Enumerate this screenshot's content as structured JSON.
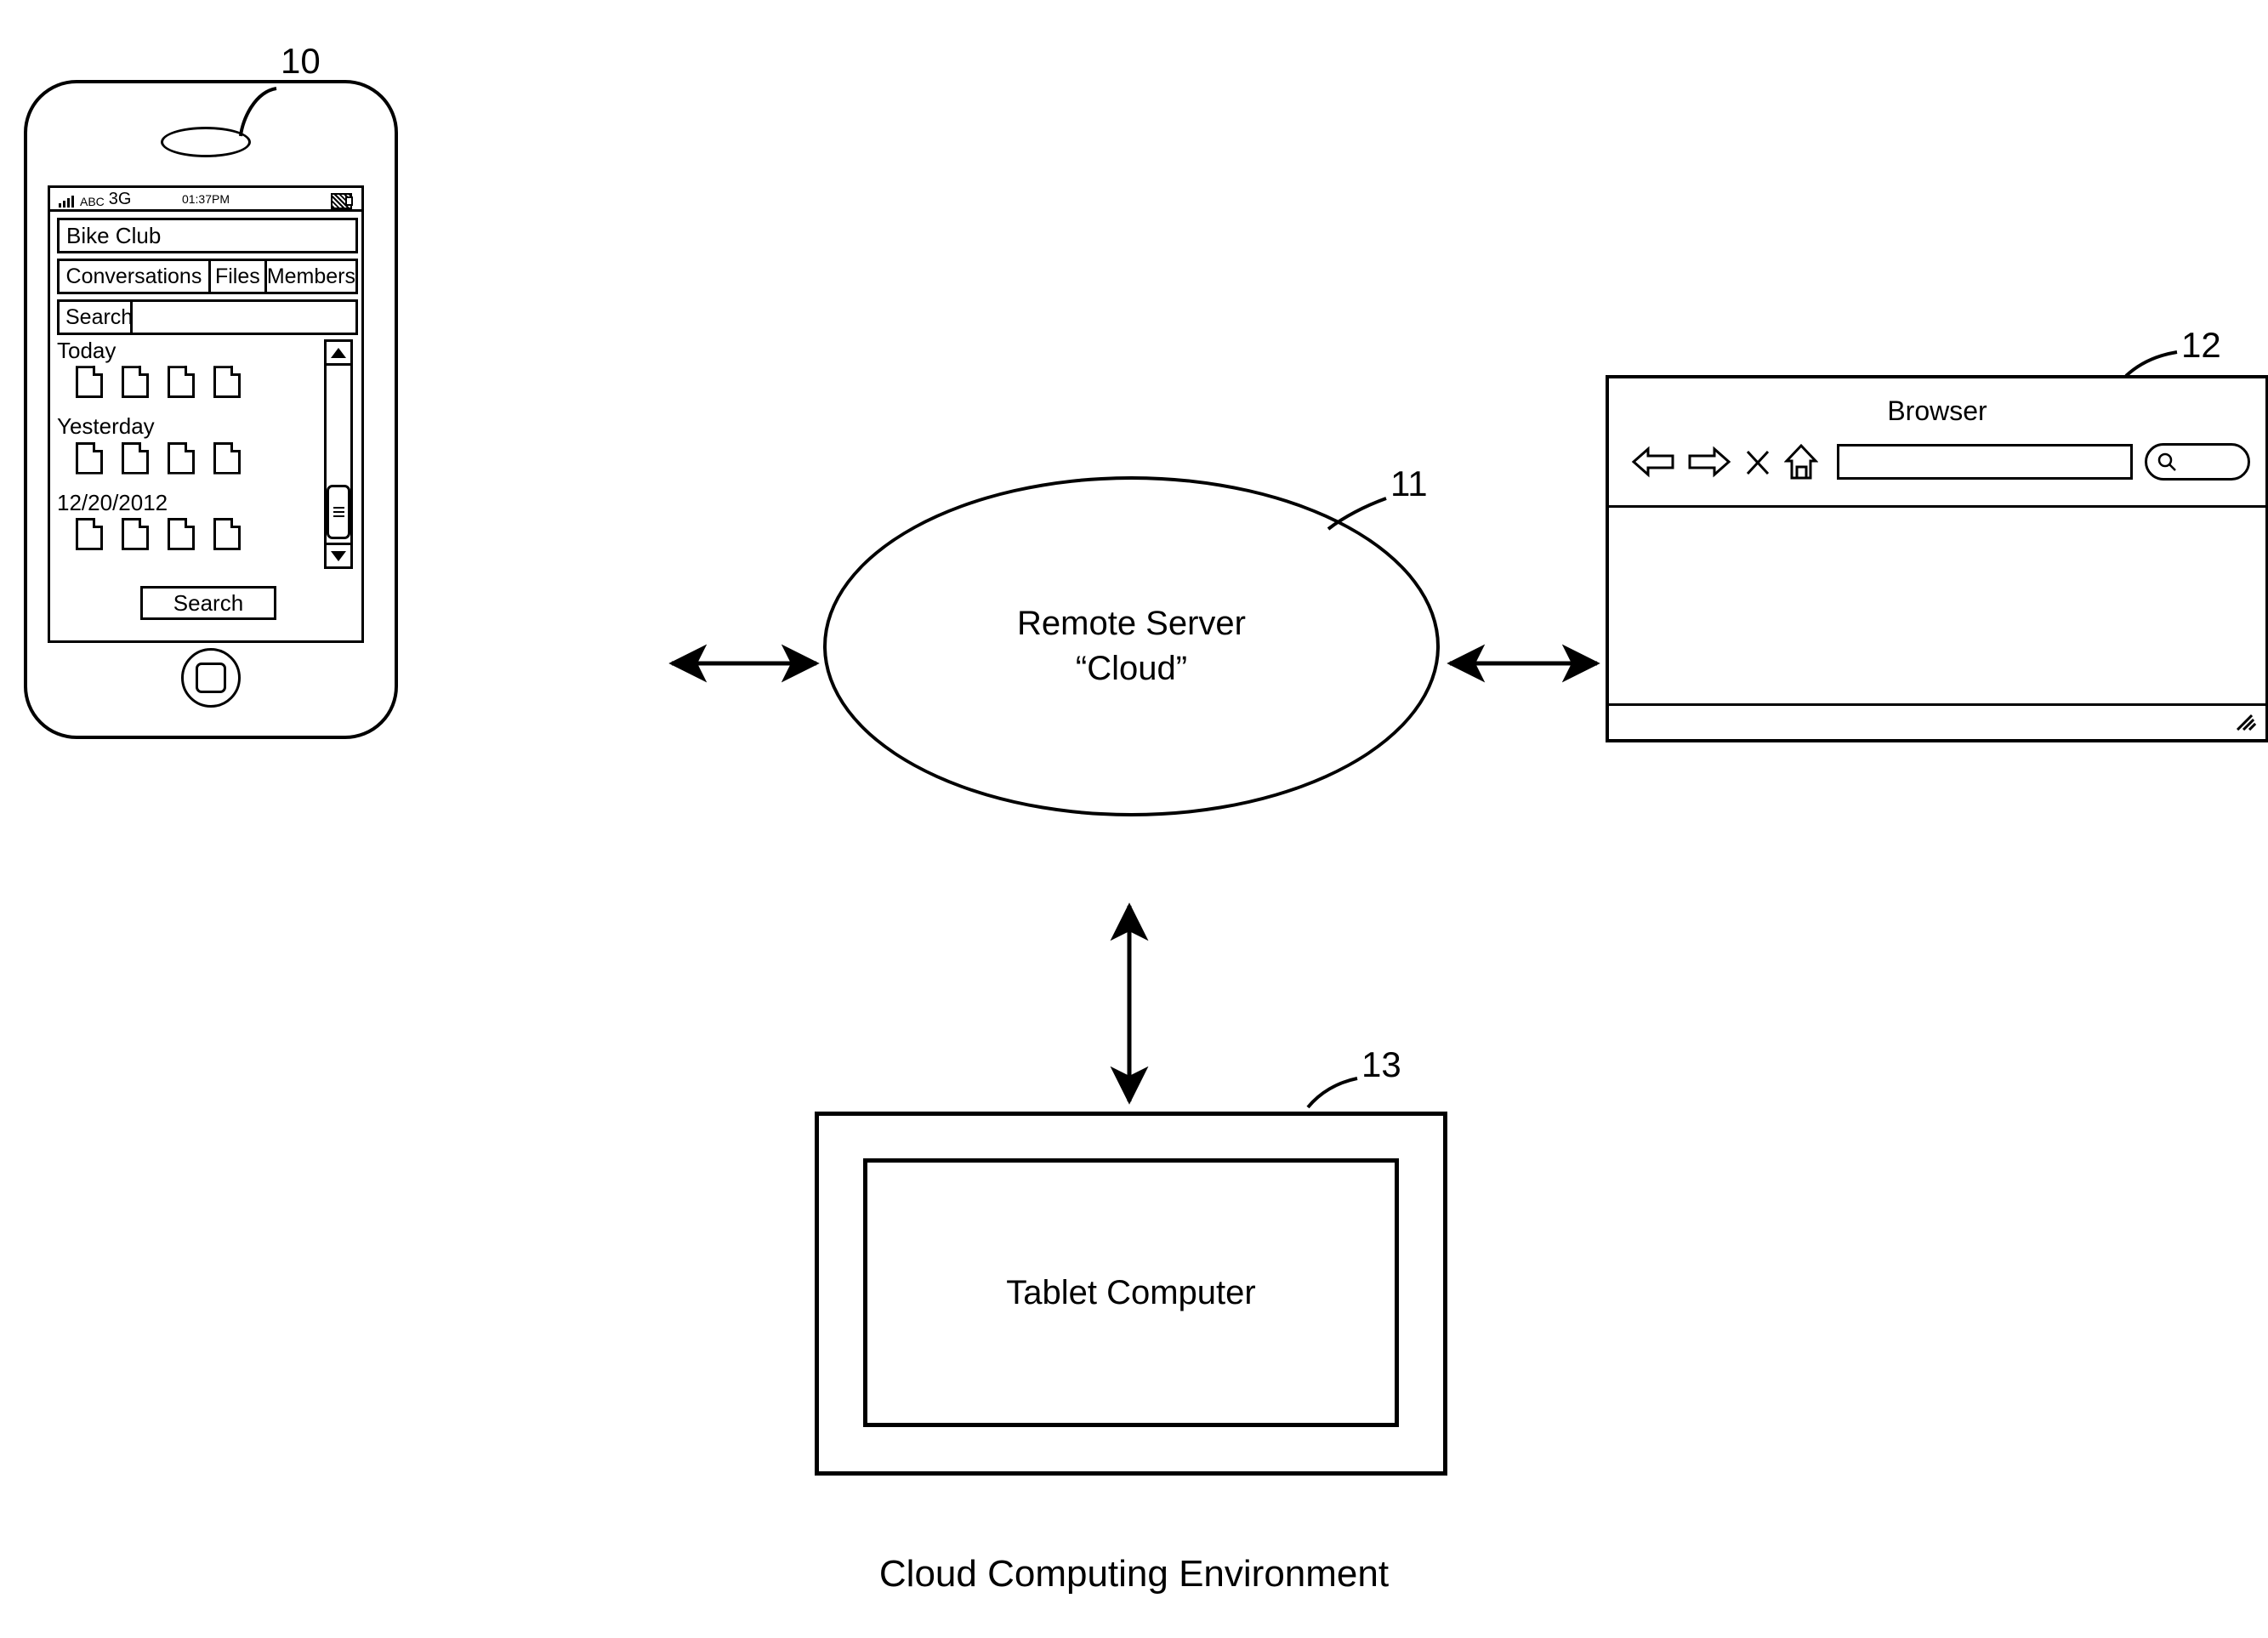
{
  "figure": {
    "caption": "Cloud Computing Environment"
  },
  "phone": {
    "ref": "10",
    "icons": {
      "speaker": "speaker-grille-icon",
      "home": "home-button-icon",
      "signal": "signal-bars-icon",
      "battery": "battery-icon"
    },
    "status_bar": {
      "carrier": "ABC",
      "network": "3G",
      "time": "01:37PM"
    },
    "title_field": {
      "value": "Bike Club"
    },
    "tabs": [
      {
        "label": "Conversations"
      },
      {
        "label": "Files"
      },
      {
        "label": "Members"
      }
    ],
    "search_row": {
      "label": "Search",
      "input_value": ""
    },
    "file_groups": [
      {
        "label": "Today",
        "file_count": 4
      },
      {
        "label": "Yesterday",
        "file_count": 4
      },
      {
        "label": "12/20/2012",
        "file_count": 4
      }
    ],
    "scrollbar": {
      "up_icon": "triangle-up-icon",
      "down_icon": "triangle-down-icon",
      "thumb_icon": "grip-lines-icon"
    },
    "search_button": {
      "label": "Search"
    }
  },
  "cloud": {
    "ref": "11",
    "line1": "Remote Server",
    "line2": "“Cloud”"
  },
  "browser": {
    "ref": "12",
    "title": "Browser",
    "toolbar": {
      "back_icon": "arrow-left-icon",
      "forward_icon": "arrow-right-icon",
      "stop_icon": "close-x-icon",
      "home_icon": "home-icon",
      "url_value": "",
      "search_icon": "magnifier-icon"
    },
    "status_bar": {
      "resize_icon": "resize-grip-icon"
    }
  },
  "tablet": {
    "ref": "13",
    "label": "Tablet Computer"
  },
  "connectors": [
    {
      "name": "phone-to-cloud",
      "type": "double-arrow",
      "orientation": "horizontal"
    },
    {
      "name": "cloud-to-browser",
      "type": "double-arrow",
      "orientation": "horizontal"
    },
    {
      "name": "cloud-to-tablet",
      "type": "double-arrow",
      "orientation": "vertical"
    }
  ]
}
